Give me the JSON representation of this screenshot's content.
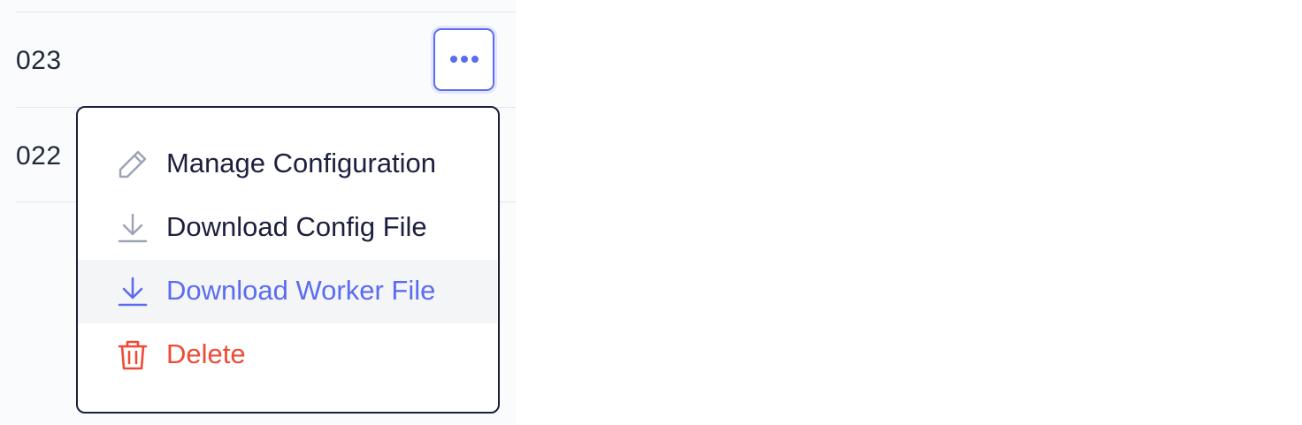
{
  "table": {
    "rows": [
      {
        "text": "023"
      },
      {
        "text": "022"
      }
    ]
  },
  "row_actions_button": {
    "icon": "more-horizontal-icon",
    "color": "#5b6cf0"
  },
  "menu": {
    "items": [
      {
        "label": "Manage Configuration",
        "icon": "pencil-icon",
        "state": "default"
      },
      {
        "label": "Download Config File",
        "icon": "download-icon",
        "state": "default"
      },
      {
        "label": "Download Worker File",
        "icon": "download-icon",
        "state": "hover"
      },
      {
        "label": "Delete",
        "icon": "trash-icon",
        "state": "danger"
      }
    ]
  },
  "colors": {
    "accent": "#5b6cf0",
    "danger": "#ee4b36",
    "text": "#1c1f3d",
    "muted_icon": "#9ca3b4"
  }
}
